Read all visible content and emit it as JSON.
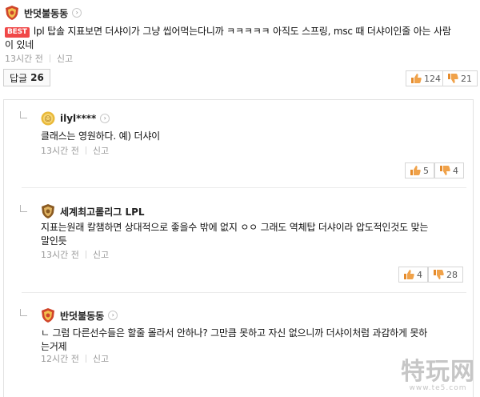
{
  "top_comment": {
    "author": "반덧불동동",
    "badge_label": "BEST",
    "text_line1": "lpl 탑솔 지표보면 더샤이가 그냥 씹어먹는다니까 ㅋㅋㅋㅋㅋ 아직도 스프링, msc 때 더샤이인줄 아는 사람",
    "text_line2": "이 있네",
    "time": "13시간 전",
    "report": "신고",
    "reply_label": "답글",
    "reply_count": "26",
    "likes": "124",
    "dislikes": "21"
  },
  "replies": [
    {
      "author": "ilyl****",
      "text_line1": "클래스는 영원하다. 예) 더샤이",
      "text_line2": "",
      "time": "13시간 전",
      "report": "신고",
      "likes": "5",
      "dislikes": "4"
    },
    {
      "author": "세계최고롤리그 LPL",
      "text_line1": "지표는원래 칼챔하면 상대적으로 좋을수 밖에 없지 ㅇㅇ 그래도 역체탑 더샤이라 압도적인것도 맞는",
      "text_line2": "말인듯",
      "time": "13시간 전",
      "report": "신고",
      "likes": "4",
      "dislikes": "28"
    },
    {
      "author": "반덧불동동",
      "text_line1": "ㄴ 그럼 다른선수들은 할줄 몰라서 안하나? 그만큼 못하고 자신 없으니까 더샤이처럼 과감하게 못하",
      "text_line2": "는거제",
      "time": "12시간 전",
      "report": "신고"
    }
  ],
  "watermark": {
    "main": "特玩网",
    "sub": "www.te5.com"
  },
  "colors": {
    "best_badge": "#f04848",
    "like_icon": "#e58b2c",
    "dislike_icon": "#e58b2c",
    "meta_text": "#999999"
  },
  "icons": {
    "badge": "shield-badge-icon",
    "chevron": "chevron-right-icon",
    "like": "thumbs-up-icon",
    "dislike": "thumbs-down-icon",
    "reply_indent": "reply-arrow-icon"
  }
}
